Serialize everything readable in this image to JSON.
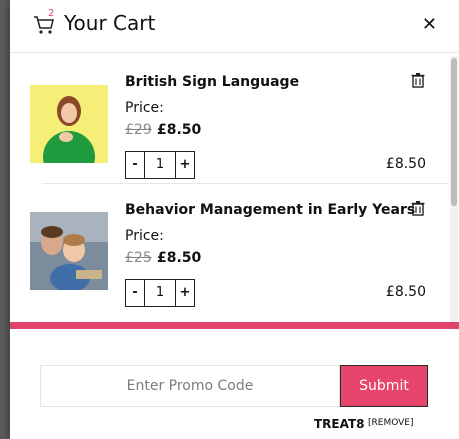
{
  "header": {
    "title": "Your Cart",
    "cart_badge": "2"
  },
  "items": [
    {
      "name": "British Sign Language",
      "price_label": "Price:",
      "old_price": "£29",
      "new_price": "£8.50",
      "qty_minus": "-",
      "qty": "1",
      "qty_plus": "+",
      "line_total": "£8.50"
    },
    {
      "name": "Behavior Management in Early Years",
      "price_label": "Price:",
      "old_price": "£25",
      "new_price": "£8.50",
      "qty_minus": "-",
      "qty": "1",
      "qty_plus": "+",
      "line_total": "£8.50"
    }
  ],
  "promo": {
    "placeholder": "Enter Promo Code",
    "submit_label": "Submit",
    "applied_code": "TREAT8",
    "remove_label": "[REMOVE]"
  },
  "colors": {
    "accent": "#e8456c",
    "thumb1_bg": "#f5ef77"
  }
}
